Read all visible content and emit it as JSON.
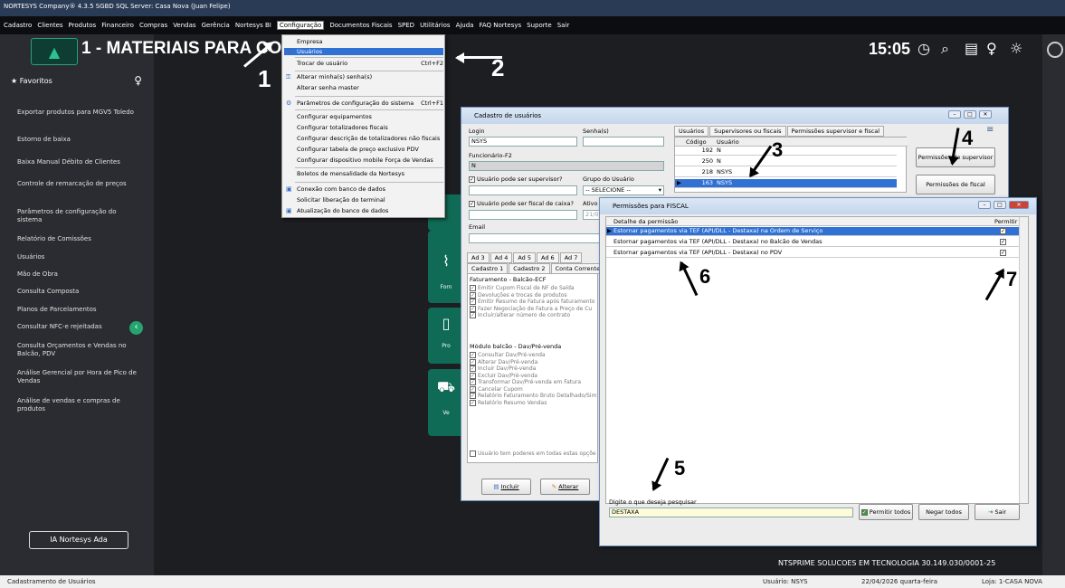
{
  "window_title": "NORTESYS Company® 4.3.5 SGBD SQL Server: Casa Nova (Juan Felipe)",
  "menu": [
    "Cadastro",
    "Clientes",
    "Produtos",
    "Financeiro",
    "Compras",
    "Vendas",
    "Gerência",
    "Nortesys BI",
    "Configuração",
    "Documentos Fiscais",
    "SPED",
    "Utilitários",
    "Ajuda",
    "FAQ Nortesys",
    "Suporte",
    "Sair"
  ],
  "page_title": "1 - MATERIAIS PARA CONT",
  "clock": "15:05",
  "sidebar": {
    "favorites": "Favoritos",
    "items": [
      "Exportar produtos para MGV5 Toledo",
      "Estorno de baixa",
      "Baixa Manual Débito de Clientes",
      "Controle de remarcação de preços",
      "Parâmetros de configuração do sistema",
      "Relatório de Comissões",
      "Usuários",
      "Mão de Obra",
      "Consulta Composta",
      "Planos de Parcelamentos",
      "Consultar NFC-e rejeitadas",
      "Consulta Orçamentos e Vendas no Balcão, PDV",
      "Análise Gerencial por Hora de Pico de Vendas",
      "Análise de vendas e compras de produtos"
    ],
    "ia_button": "IA Nortesys Ada"
  },
  "dropdown": {
    "items": [
      {
        "label": "Empresa",
        "shortcut": ""
      },
      {
        "label": "Usuários",
        "shortcut": ""
      },
      {
        "label": "Trocar de usuário",
        "shortcut": "Ctrl+F2"
      },
      {
        "label": "Alterar minha(s) senha(s)",
        "shortcut": ""
      },
      {
        "label": "Alterar senha master",
        "shortcut": ""
      },
      {
        "label": "Parâmetros de configuração do sistema",
        "shortcut": "Ctrl+F1"
      },
      {
        "label": "Configurar equipamentos",
        "shortcut": ""
      },
      {
        "label": "Configurar totalizadores fiscais",
        "shortcut": ""
      },
      {
        "label": "Configurar descrição de totalizadores não fiscais",
        "shortcut": ""
      },
      {
        "label": "Configurar tabela de preço exclusivo PDV",
        "shortcut": ""
      },
      {
        "label": "Configurar dispositivo mobile Força de Vendas",
        "shortcut": ""
      },
      {
        "label": "Boletos de mensalidade da Nortesys",
        "shortcut": ""
      },
      {
        "label": "Conexão com banco de dados",
        "shortcut": ""
      },
      {
        "label": "Solicitar liberação do terminal",
        "shortcut": ""
      },
      {
        "label": "Atualização do banco de dados",
        "shortcut": ""
      }
    ]
  },
  "tiles": [
    "Forn",
    "Pro",
    "Ve"
  ],
  "cadastro": {
    "title": "Cadastro de usuários",
    "login_label": "Login",
    "login_value": "NSYS",
    "senha_label": "Senha(s)",
    "funcionario_label": "Funcionário-F2",
    "funcionario_value": "N",
    "chk_supervisor": "Usuário pode ser supervisor?",
    "grupo_label": "Grupo do Usuário",
    "grupo_value": "-- SELECIONE --",
    "chk_fiscal": "Usuário pode ser fiscal de caixa?",
    "ativo_label": "Ativo",
    "ativo_value": "21/0",
    "email_label": "Email",
    "tabs_row1": [
      "Ad 3",
      "Ad 4",
      "Ad 5",
      "Ad 6",
      "Ad 7"
    ],
    "tabs_row2": [
      "Cadastro 1",
      "Cadastro 2",
      "Conta Corrente/D"
    ],
    "fat_title": "Faturamento - Balcão-ECF",
    "fat_items": [
      "Emitir Cupom Fiscal de NF de Saída",
      "Devoluções e trocas de produtos",
      "Emitir Resumo de Fatura após faturamento",
      "Fazer Negociação de Fatura a Preço de Cu",
      "Incluir/alterar número de contrato"
    ],
    "dav_title": "Módulo balcão - Dav/Pré-venda",
    "dav_items": [
      "Consultar Dav/Pré-venda",
      "Alterar Dav/Pré-venda",
      "Incluir Dav/Pré-venda",
      "Excluir Dav/Pré-venda",
      "Transformar Dav/Pré-venda em Fatura",
      "Cancelar Cupom",
      "Relatório Faturamento Bruto Detalhado/Sim",
      "Relatório Resumo Vendas"
    ],
    "poderes": "Usuário tem poderes em todas estas opçõe",
    "btn_incluir": "Incluir",
    "btn_alterar": "Alterar",
    "right_tabs": [
      "Usuários",
      "Supervisores ou fiscais",
      "Permissões supervisor e fiscal"
    ],
    "grid_headers": [
      "Código",
      "Usuário"
    ],
    "grid_rows": [
      {
        "codigo": "192",
        "usuario": "N"
      },
      {
        "codigo": "250",
        "usuario": "N"
      },
      {
        "codigo": "218",
        "usuario": "NSYS"
      },
      {
        "codigo": "163",
        "usuario": "NSYS"
      }
    ],
    "btn_perm_supervisor": "Permissões de supervisor",
    "btn_perm_fiscal": "Permissões de fiscal"
  },
  "permissoes": {
    "title": "Permissões para FISCAL",
    "col_detalhe": "Detalhe da permissão",
    "col_permitir": "Permitir",
    "rows": [
      "Estornar pagamentos via TEF (API/DLL - Destaxa) na Ordem de Serviço",
      "Estornar pagamentos via TEF (API/DLL - Destaxa) no Balcão de Vendas",
      "Estornar pagamentos via TEF (API/DLL - Destaxa) no PDV"
    ],
    "search_label": "Digite o que deseja pesquisar",
    "search_value": "DESTAXA",
    "btn_permitir_todos": "Permitir todos",
    "btn_negar_todos": "Negar todos",
    "btn_sair": "Sair"
  },
  "annotations": [
    "1",
    "2",
    "3",
    "4",
    "5",
    "6",
    "7"
  ],
  "footer_company": "NTSPRIME SOLUCOES EM TECNOLOGIA    30.149.030/0001-25",
  "status": {
    "left": "Cadastramento de Usuários",
    "user": "Usuário: NSYS",
    "date": "22/04/2026 quarta-feira",
    "store": "Loja: 1-CASA NOVA"
  },
  "colors": {
    "accent": "#3071d4",
    "green": "#0f6b55",
    "dark": "#1d1e22"
  }
}
